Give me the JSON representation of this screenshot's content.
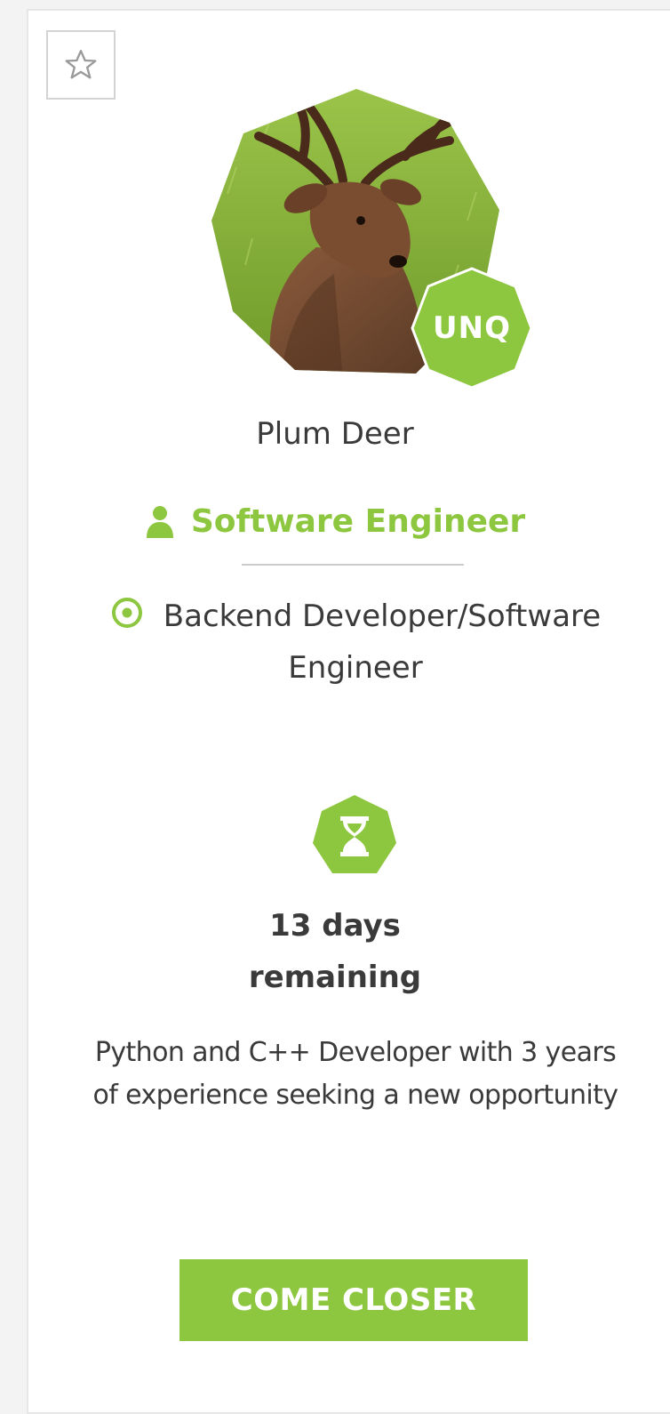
{
  "card": {
    "favorite_icon": "star-outline-icon",
    "badge_text": "UNQ",
    "name": "Plum Deer",
    "role_icon": "user-icon",
    "role": "Software Engineer",
    "specialization_icon": "target-icon",
    "specialization": "Backend Developer/Software Engineer",
    "timer_icon": "hourglass-icon",
    "remaining_line1": "13 days",
    "remaining_line2": "remaining",
    "description": "Python and C++ Developer with 3 years of experience seeking a new opportunity",
    "cta_label": "COME CLOSER"
  },
  "colors": {
    "accent": "#8dc63f",
    "text": "#3a3a3a",
    "border": "#e6e6e6"
  }
}
